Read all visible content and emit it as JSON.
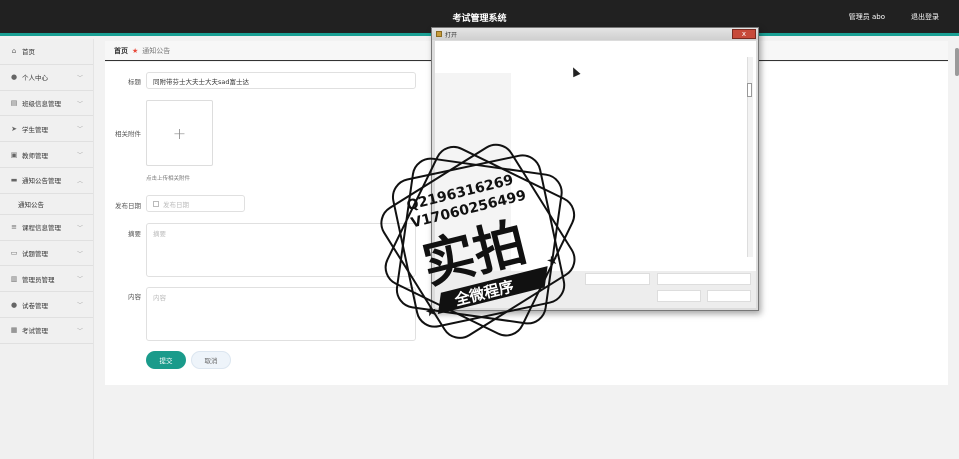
{
  "header": {
    "title": "考试管理系统",
    "user": "管理员 abo",
    "logout": "退出登录"
  },
  "sidebar": {
    "items": [
      {
        "label": "首页",
        "icon": "home-icon"
      },
      {
        "label": "个人中心",
        "icon": "user-icon"
      },
      {
        "label": "班级信息管理",
        "icon": "list-icon"
      },
      {
        "label": "学生管理",
        "icon": "send-icon"
      },
      {
        "label": "教师管理",
        "icon": "doc-icon"
      },
      {
        "label": "通知公告管理",
        "icon": "message-icon"
      },
      {
        "label": "课程信息管理",
        "icon": "layers-icon"
      },
      {
        "label": "试题管理",
        "icon": "card-icon"
      },
      {
        "label": "管理员管理",
        "icon": "chart-icon"
      },
      {
        "label": "试卷管理",
        "icon": "person-icon"
      },
      {
        "label": "考试管理",
        "icon": "clipboard-icon"
      }
    ],
    "sub_item": "通知公告"
  },
  "breadcrumb": {
    "home": "首页",
    "current": "通知公告"
  },
  "form": {
    "title_label": "标题",
    "title_value": "同附带芬士大夫士大夫sad富士达",
    "attachment_label": "相关附件",
    "attachment_hint": "点击上传相关附件",
    "date_label": "发布日期",
    "date_placeholder": "发布日期",
    "summary_label": "摘要",
    "summary_placeholder": "摘要",
    "content_label": "内容",
    "content_placeholder": "内容",
    "submit": "提交",
    "cancel": "取消"
  },
  "dialog": {
    "title": "打开",
    "close": "x"
  },
  "stamp": {
    "line1": "Q2196316269",
    "line2": "V17060256499",
    "big": "实拍",
    "ribbon": "全微程序"
  },
  "colors": {
    "accent": "#1aa094",
    "topbar": "#212121",
    "submit": "#1a9b8b",
    "star": "#e8493a"
  }
}
